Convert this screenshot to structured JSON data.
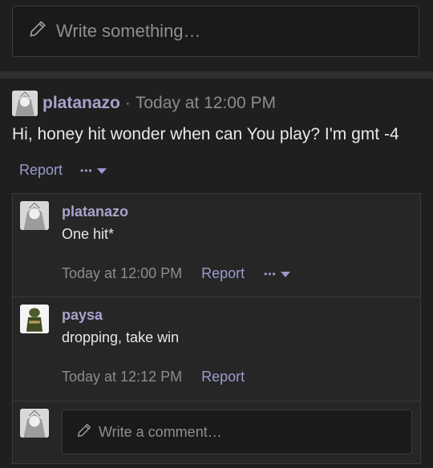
{
  "composer": {
    "placeholder": "Write something…",
    "icon": "pencil-icon"
  },
  "post": {
    "author": "platanazo",
    "separator": "·",
    "time": "Today at 12:00 PM",
    "body": "Hi, honey hit wonder when can You play? I'm gmt -4",
    "report_label": "Report",
    "more_label": "•••"
  },
  "comments": [
    {
      "author": "platanazo",
      "text": "One hit*",
      "time": "Today at 12:00 PM",
      "report_label": "Report",
      "more_label": "•••"
    },
    {
      "author": "paysa",
      "text": "dropping, take win",
      "time": "Today at 12:12 PM",
      "report_label": "Report"
    }
  ],
  "comment_composer": {
    "placeholder": "Write a comment…",
    "icon": "pencil-icon"
  },
  "colors": {
    "username": "#a8a3cc",
    "link": "#9a9acf",
    "muted": "#8c8c8c",
    "background": "#1f1f1f"
  }
}
